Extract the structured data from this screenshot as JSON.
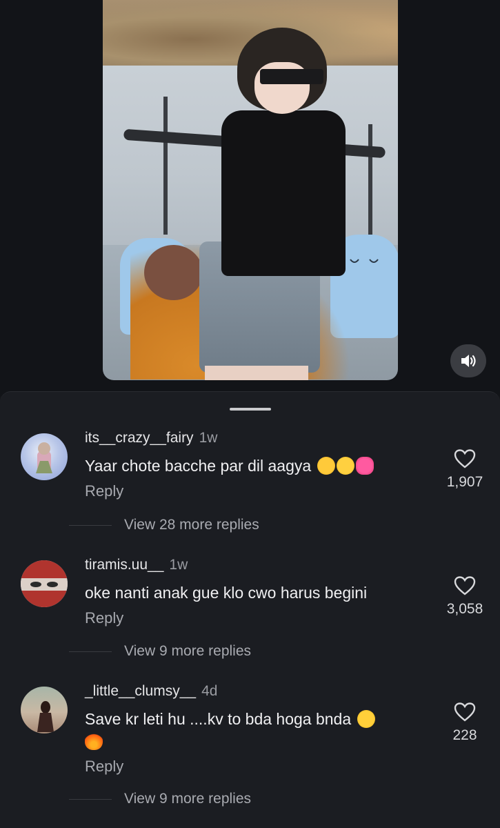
{
  "video": {
    "sound_icon": "speaker-icon"
  },
  "comments": [
    {
      "username": "its__crazy__fairy",
      "time": "1w",
      "text": "Yaar chote bacche par dil aagya",
      "emojis": [
        "smiling-face-with-hearts",
        "crying-face",
        "heart-with-ribbon"
      ],
      "reply_label": "Reply",
      "likes": "1,907",
      "view_more": "View 28 more replies"
    },
    {
      "username": "tiramis.uu__",
      "time": "1w",
      "text": "oke nanti anak gue klo cwo harus begini",
      "emojis": [],
      "reply_label": "Reply",
      "likes": "3,058",
      "view_more": "View 9 more replies"
    },
    {
      "username": "_little__clumsy__",
      "time": "4d",
      "text": "Save kr leti hu ....kv to bda hoga bnda",
      "emojis": [
        "face-with-tears-of-joy",
        "fire"
      ],
      "reply_label": "Reply",
      "likes": "228",
      "view_more": "View 9 more replies"
    }
  ],
  "colors": {
    "background": "#15171b",
    "sheet": "#1b1d22",
    "secondary_text": "#a8aab0"
  }
}
